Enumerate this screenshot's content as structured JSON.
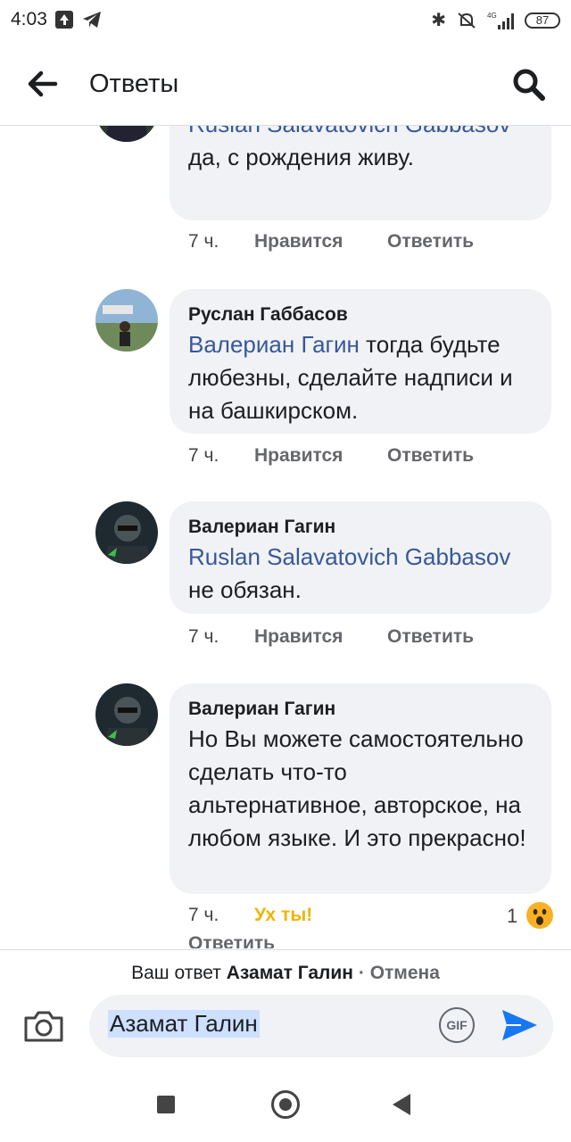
{
  "status_bar": {
    "time": "4:03",
    "network": "4G",
    "battery": "87",
    "icons": [
      "upload-icon",
      "telegram-icon",
      "bluetooth-icon",
      "mute-icon",
      "signal-icon",
      "battery-icon"
    ]
  },
  "header": {
    "title": "Ответы",
    "back_icon": "arrow-left-icon",
    "search_icon": "search-icon"
  },
  "comments": [
    {
      "author": "",
      "mention": "Ruslan Salavatovich Gabbasov",
      "text": " да, с рождения живу.",
      "time": "7 ч.",
      "like": "Нравится",
      "reply": "Ответить"
    },
    {
      "author": "Руслан Габбасов",
      "mention": "Валериан Гагин",
      "text": " тогда будьте любезны, сделайте надписи и на башкирском.",
      "time": "7 ч.",
      "like": "Нравится",
      "reply": "Ответить"
    },
    {
      "author": "Валериан Гагин",
      "mention": "Ruslan Salavatovich Gabbasov",
      "text": " не обязан.",
      "time": "7 ч.",
      "like": "Нравится",
      "reply": "Ответить"
    },
    {
      "author": "Валериан Гагин",
      "mention": "",
      "text": "Но Вы можете самостоятельно сделать что-то альтернативное, авторское, на любом языке. И это прекрасно!",
      "time": "7 ч.",
      "like": "Ух ты!",
      "reply": "Ответить",
      "reaction_count": "1"
    }
  ],
  "reply_bar": {
    "prefix": "Ваш ответ",
    "target": "Азамат Галин",
    "separator": "·",
    "cancel": "Отмена",
    "input_value": "Азамат Галин",
    "gif_label": "GIF",
    "camera_icon": "camera-icon",
    "send_icon": "send-icon"
  },
  "colors": {
    "mention": "#385898",
    "bubble": "#f0f2f5",
    "wow": "#f0b400",
    "send": "#1877f2"
  }
}
